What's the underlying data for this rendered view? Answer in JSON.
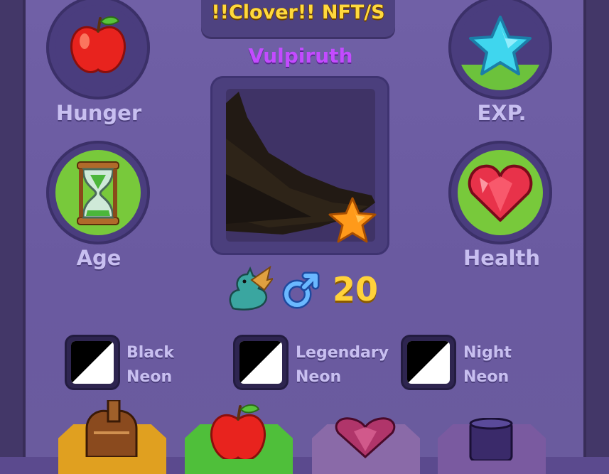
{
  "title": "!!Clover!! NFT/S",
  "pet": {
    "name": "Vulpiruth",
    "age": "20",
    "gender_icon": "male-symbol-icon",
    "species_icon": "dragon-icon",
    "rarity_icon": "star-icon"
  },
  "stats": [
    {
      "label": "Hunger",
      "icon": "apple-icon",
      "fill": 0
    },
    {
      "label": "EXP.",
      "icon": "star-icon",
      "fill": 0.28
    },
    {
      "label": "Age",
      "icon": "hourglass-icon",
      "fill": 1
    },
    {
      "label": "Health",
      "icon": "heart-icon",
      "fill": 1
    }
  ],
  "toggles": [
    {
      "line1": "Black",
      "line2": "Neon"
    },
    {
      "line1": "Legendary",
      "line2": "Neon"
    },
    {
      "line1": "Night",
      "line2": "Neon"
    }
  ],
  "slots": [
    {
      "icon": "saddle-icon",
      "color": "#e0a020"
    },
    {
      "icon": "apple-icon",
      "color": "#4fbf3a"
    },
    {
      "icon": "heart-gem-icon",
      "color": "#8a5aa8"
    },
    {
      "icon": "top-hat-icon",
      "color": "#7a5aa0"
    }
  ],
  "colors": {
    "title": "#ffd93d",
    "name": "#c34bff",
    "age_number": "#ffd23a",
    "fill_green": "#78c93b"
  }
}
